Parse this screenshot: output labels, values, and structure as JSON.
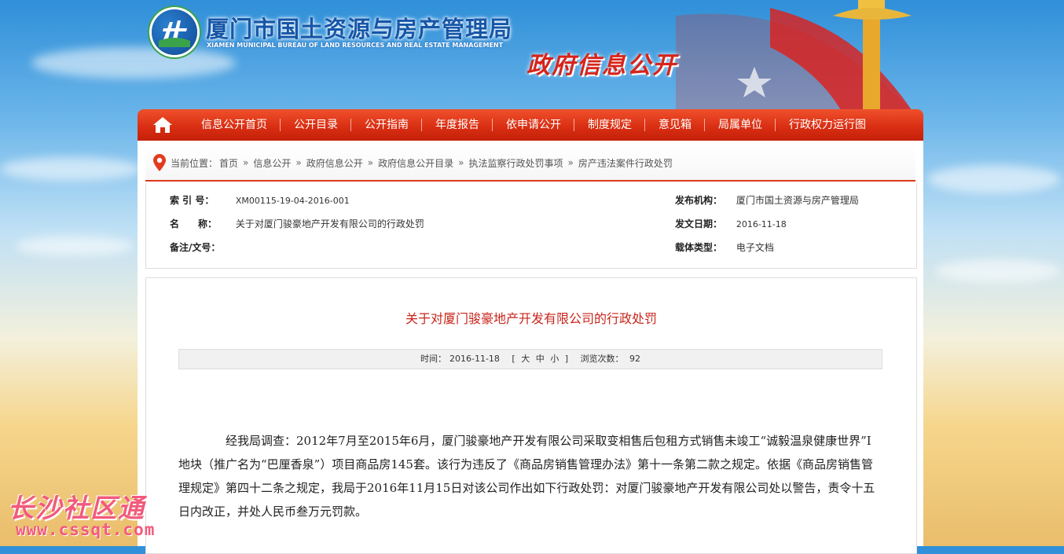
{
  "header": {
    "title": "厦门市国土资源与房产管理局",
    "subtitle": "XIAMEN MUNICIPAL BUREAU OF LAND RESOURCES AND REAL ESTATE MANAGEMENT",
    "gov_title": "政府信息公开"
  },
  "nav": {
    "home_icon": "home-icon",
    "items": [
      "信息公开首页",
      "公开目录",
      "公开指南",
      "年度报告",
      "依申请公开",
      "制度规定",
      "意见箱",
      "局属单位",
      "行政权力运行图"
    ]
  },
  "breadcrumb": {
    "label": "当前位置：",
    "items": [
      "首页",
      "信息公开",
      "政府信息公开",
      "政府信息公开目录",
      "执法监察行政处罚事项",
      "房产违法案件行政处罚"
    ],
    "separator": "»"
  },
  "meta": {
    "index_label": "索 引 号：",
    "index_value": "XM00115-19-04-2016-001",
    "name_label": "名　　称：",
    "name_value": "关于对厦门骏豪地产开发有限公司的行政处罚",
    "remark_label": "备注/文号：",
    "remark_value": "",
    "publisher_label": "发布机构：",
    "publisher_value": "厦门市国土资源与房产管理局",
    "date_label": "发文日期：",
    "date_value": "2016-11-18",
    "carrier_label": "载体类型：",
    "carrier_value": "电子文档"
  },
  "article": {
    "title": "关于对厦门骏豪地产开发有限公司的行政处罚",
    "time_label": "时间：",
    "time_value": "2016-11-18",
    "font_open": "[",
    "font_large": "大",
    "font_medium": "中",
    "font_small": "小",
    "font_close": "]",
    "views_label": "浏览次数：",
    "views_value": "92",
    "body": "经我局调查：2012年7月至2015年6月，厦门骏豪地产开发有限公司采取变相售后包租方式销售未竣工“诚毅温泉健康世界”Ⅰ地块（推广名为“巴厘香泉”）项目商品房145套。该行为违反了《商品房销售管理办法》第十一条第二款之规定。依据《商品房销售管理规定》第四十二条之规定，我局于2016年11月15日对该公司作出如下行政处罚：对厦门骏豪地产开发有限公司处以警告，责令十五日内改正，并处人民币叁万元罚款。"
  },
  "watermark": {
    "text": "长沙社区通",
    "url": "www.cssqt.com"
  },
  "colors": {
    "nav_red": "#d82d12",
    "title_red": "#c8251b",
    "brand_blue": "#1656a8",
    "watermark_pink": "#f25a7c"
  }
}
